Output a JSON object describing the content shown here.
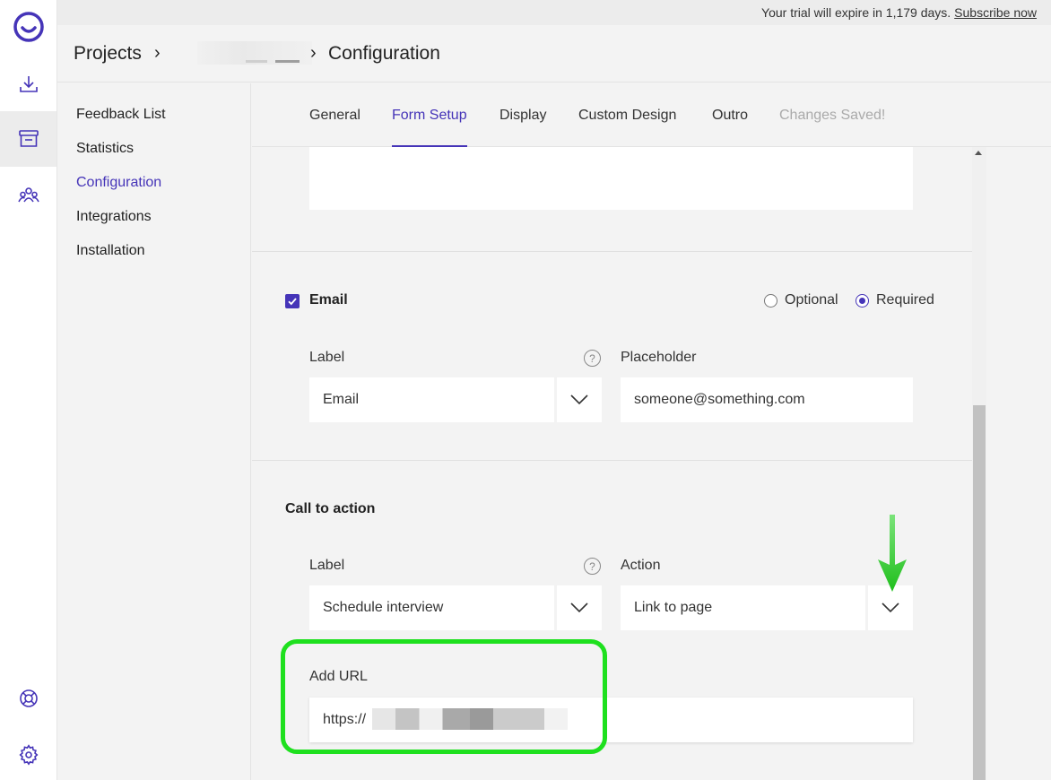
{
  "topbar": {
    "trial_text": "Your trial will expire in 1,179 days.",
    "subscribe_label": "Subscribe now"
  },
  "breadcrumb": {
    "root": "Projects",
    "separator": "›",
    "current": "Configuration"
  },
  "sidebar": {
    "items": [
      {
        "label": "Feedback List"
      },
      {
        "label": "Statistics"
      },
      {
        "label": "Configuration"
      },
      {
        "label": "Integrations"
      },
      {
        "label": "Installation"
      }
    ]
  },
  "tabs": [
    {
      "label": "General"
    },
    {
      "label": "Form Setup"
    },
    {
      "label": "Display"
    },
    {
      "label": "Custom Design"
    },
    {
      "label": "Outro"
    },
    {
      "label": "Changes Saved!"
    }
  ],
  "email_section": {
    "title": "Email",
    "optional_label": "Optional",
    "required_label": "Required",
    "label_caption": "Label",
    "label_value": "Email",
    "placeholder_caption": "Placeholder",
    "placeholder_value": "someone@something.com"
  },
  "cta_section": {
    "title": "Call to action",
    "label_caption": "Label",
    "label_value": "Schedule interview",
    "action_caption": "Action",
    "action_value": "Link to page",
    "url_caption": "Add URL",
    "url_value": "https://"
  },
  "help_glyph": "?",
  "colors": {
    "accent": "#4534b8",
    "highlight": "#1ee01e",
    "arrow": "#22c41e"
  },
  "icons": {
    "rail": [
      "logo-icon",
      "download-icon",
      "inbox-icon",
      "team-icon",
      "lifebuoy-icon",
      "gear-icon"
    ]
  }
}
